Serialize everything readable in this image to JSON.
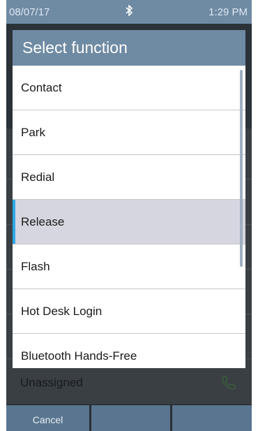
{
  "status_bar": {
    "date": "08/07/17",
    "bluetooth_icon": "bluetooth-icon",
    "time": "1:29 PM"
  },
  "background": {
    "unassigned_label": "Unassigned",
    "phone_icon": "phone-icon"
  },
  "dialog": {
    "title": "Select function",
    "items": [
      {
        "label": "Contact",
        "selected": false
      },
      {
        "label": "Park",
        "selected": false
      },
      {
        "label": "Redial",
        "selected": false
      },
      {
        "label": "Release",
        "selected": true
      },
      {
        "label": "Flash",
        "selected": false
      },
      {
        "label": "Hot Desk Login",
        "selected": false
      },
      {
        "label": "Bluetooth Hands-Free",
        "selected": false
      }
    ]
  },
  "softkeys": [
    {
      "label": "Cancel"
    },
    {
      "label": ""
    },
    {
      "label": ""
    }
  ],
  "colors": {
    "accent": "#6f8aa3",
    "selection": "#d6d6e0",
    "selection_marker": "#2ea8e5"
  }
}
